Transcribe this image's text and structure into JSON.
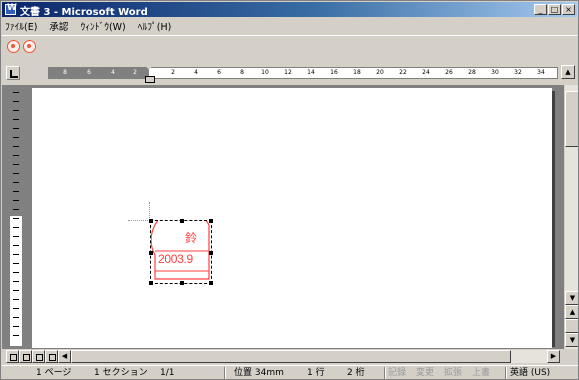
{
  "window": {
    "title": "文書 3 - Microsoft Word",
    "buttons": {
      "minimize": "_",
      "maximize": "□",
      "close": "×"
    }
  },
  "menu": {
    "items": [
      {
        "label": "ﾌｧｲﾙ(E)"
      },
      {
        "label": "承認"
      },
      {
        "label": "ｳｨﾝﾄﾞｳ(W)"
      },
      {
        "label": "ﾍﾙﾌﾟ(H)"
      }
    ]
  },
  "toolbar": {
    "buttons": [
      {
        "icon": "stamp-tool-icon"
      },
      {
        "icon": "stamp-settings-icon"
      }
    ]
  },
  "ruler": {
    "margin_labels": [
      "8",
      "6",
      "4",
      "2"
    ],
    "labels": [
      "2",
      "4",
      "6",
      "8",
      "10",
      "12",
      "14",
      "16",
      "18",
      "20",
      "22",
      "24",
      "26",
      "28",
      "30",
      "32",
      "34"
    ]
  },
  "stamp": {
    "name": "鈴",
    "date": "2003.9",
    "color": "#ff4040"
  },
  "scrollbar": {
    "up_arrow": "▲",
    "down_arrow": "▼",
    "left_arrow": "◀",
    "right_arrow": "▶"
  },
  "statusbar": {
    "page": "1 ページ",
    "section": "1 セクション",
    "page_of": "1/1",
    "position": "位置 34mm",
    "line": "1 行",
    "column": "2 桁",
    "rec": "記録",
    "trk": "変更",
    "ext": "拡張",
    "ovr": "上書",
    "language": "英語 (US)"
  }
}
